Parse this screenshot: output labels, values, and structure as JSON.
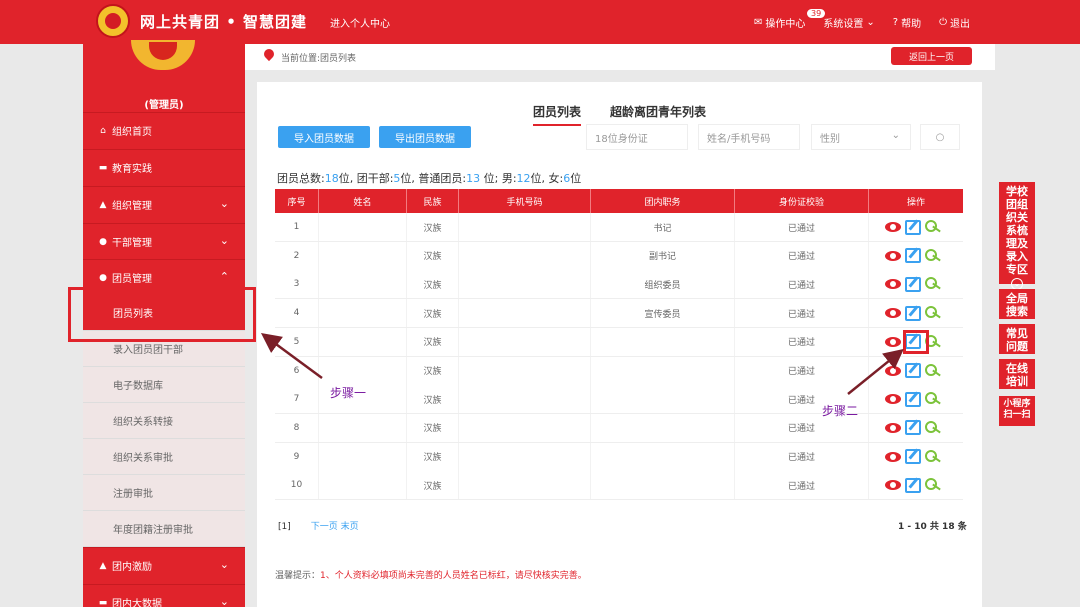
{
  "header": {
    "brand": "网上共青团 • 智慧团建",
    "personal_center": "进入个人中心",
    "ops_center": "操作中心",
    "ops_badge": "39",
    "settings": "系统设置",
    "help": "帮助",
    "logout": "退出"
  },
  "sidebar": {
    "role": "(管理员)",
    "items": [
      {
        "label": "组织首页",
        "icon": "home-icon"
      },
      {
        "label": "教育实践",
        "icon": "folder-icon"
      },
      {
        "label": "组织管理",
        "icon": "org-icon"
      },
      {
        "label": "干部管理",
        "icon": "users-icon"
      },
      {
        "label": "团员管理",
        "icon": "users-icon"
      }
    ],
    "sub_items": [
      {
        "label": "团员列表",
        "active": true
      },
      {
        "label": "录入团员团干部"
      },
      {
        "label": "电子数据库"
      },
      {
        "label": "组织关系转接"
      },
      {
        "label": "组织关系审批"
      },
      {
        "label": "注册审批"
      },
      {
        "label": "年度团籍注册审批"
      }
    ],
    "bottom_items": [
      {
        "label": "团内激励",
        "icon": "org-icon"
      },
      {
        "label": "团内大数据",
        "icon": "folder-icon"
      }
    ]
  },
  "breadcrumb": "当前位置:团员列表",
  "back_button": "返回上一页",
  "tabs": [
    "团员列表",
    "超龄离团青年列表"
  ],
  "actions": {
    "import": "导入团员数据",
    "export": "导出团员数据"
  },
  "filters": {
    "id_placeholder": "18位身份证",
    "name_placeholder": "姓名/手机号码",
    "gender": "性别"
  },
  "summary": {
    "total_label": "团员总数:",
    "total": "18",
    "cadre_label": "位, 团干部:",
    "cadre": "5",
    "member_label": "位, 普通团员:",
    "member": "13",
    "male_label": " 位; 男:",
    "male": "12",
    "female_label": "位, 女:",
    "female": "6",
    "end": "位"
  },
  "table": {
    "headers": [
      "序号",
      "姓名",
      "民族",
      "手机号码",
      "团内职务",
      "身份证校验",
      "操作"
    ],
    "rows": [
      {
        "no": "1",
        "ethnicity": "汉族",
        "role": "书记",
        "check": "已通过"
      },
      {
        "no": "2",
        "ethnicity": "汉族",
        "role": "副书记",
        "check": "已通过"
      },
      {
        "no": "3",
        "ethnicity": "汉族",
        "role": "组织委员",
        "check": "已通过"
      },
      {
        "no": "4",
        "ethnicity": "汉族",
        "role": "宣传委员",
        "check": "已通过"
      },
      {
        "no": "5",
        "ethnicity": "汉族",
        "role": "",
        "check": "已通过"
      },
      {
        "no": "6",
        "ethnicity": "汉族",
        "role": "",
        "check": "已通过"
      },
      {
        "no": "7",
        "ethnicity": "汉族",
        "role": "",
        "check": "已通过"
      },
      {
        "no": "8",
        "ethnicity": "汉族",
        "role": "",
        "check": "已通过"
      },
      {
        "no": "9",
        "ethnicity": "汉族",
        "role": "",
        "check": "已通过"
      },
      {
        "no": "10",
        "ethnicity": "汉族",
        "role": "",
        "check": "已通过"
      }
    ]
  },
  "pager": {
    "current": "[1]",
    "next": "下一页",
    "last": "末页",
    "count": "1 - 10 共 18 条"
  },
  "tip": {
    "label": "温馨提示：",
    "text": "1、个人资料必填项尚未完善的人员姓名已标红，请尽快核实完善。"
  },
  "annotations": {
    "step1": "步骤一",
    "step2": "步骤二"
  },
  "right_float": [
    "学校团组织关系梳理及录入专区",
    "全局搜索",
    "常见问题",
    "在线培训",
    "小程序扫一扫"
  ],
  "colors": {
    "primary_red": "#e0232b",
    "accent_blue": "#3aa1f0",
    "key_green": "#7cc33b",
    "annotation_purple": "#7a1aa0"
  }
}
